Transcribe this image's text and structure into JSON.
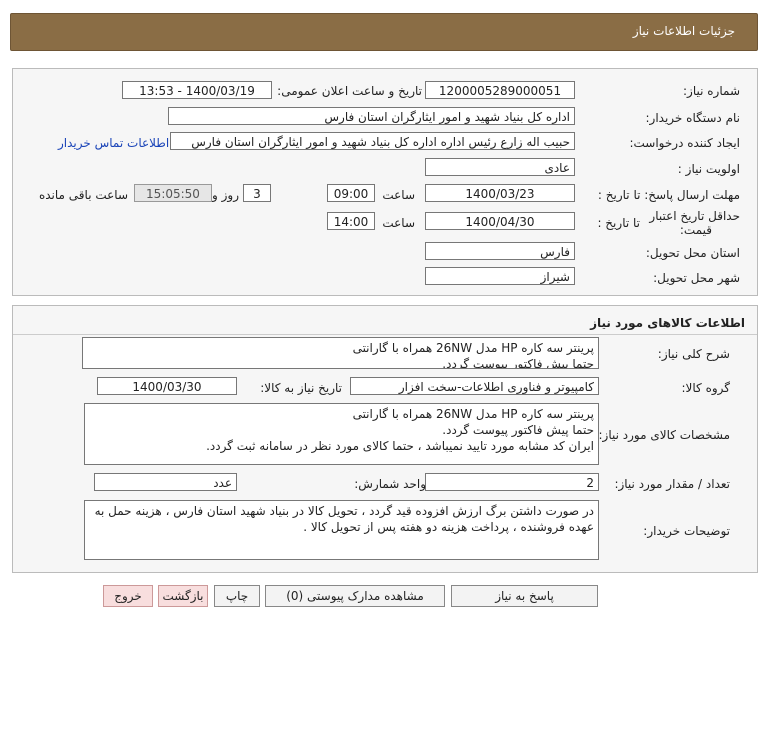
{
  "header": {
    "title": "جزئیات اطلاعات نیاز"
  },
  "info": {
    "need_no_label": "شماره نیاز:",
    "need_no": "1200005289000051",
    "announce_label": "تاریخ و ساعت اعلان عمومی:",
    "announce_value": "1400/03/19 - 13:53",
    "buyer_label": "نام دستگاه خریدار:",
    "buyer": "اداره کل بنیاد شهید و امور ایثارگران استان فارس",
    "creator_label": "ایجاد کننده درخواست:",
    "creator": "حبیب اله زارع رئیس اداره اداره کل بنیاد شهید و امور ایثارگران استان فارس",
    "contact_link": "اطلاعات تماس خریدار",
    "priority_label": "اولویت نیاز :",
    "priority": "عادی",
    "deadline_label": "مهلت ارسال پاسخ: تا تاریخ :",
    "deadline_date": "1400/03/23",
    "time_label": "ساعت",
    "deadline_time": "09:00",
    "days": "3",
    "days_label": "روز و",
    "remaining": "15:05:50",
    "remaining_label": "ساعت باقی مانده",
    "validity_label": "حداقل تاریخ اعتبار قیمت:",
    "validity_to_label": "تا تاریخ :",
    "validity_date": "1400/04/30",
    "validity_time_label": "ساعت",
    "validity_time": "14:00",
    "province_label": "استان محل تحویل:",
    "province": "فارس",
    "city_label": "شهر محل تحویل:",
    "city": "شیراز"
  },
  "goods": {
    "title": "اطلاعات کالاهای مورد نیاز",
    "desc_label": "شرح کلی نیاز:",
    "desc_line1": "پرینتر سه کاره HP مدل 26NW همراه با گارانتی",
    "desc_line2": "حتما پیش فاکتور پیوست گردد.",
    "group_label": "گروه کالا:",
    "group": "کامپیوتر و فناوری اطلاعات-سخت افزار",
    "need_date_label": "تاریخ نیاز به کالا:",
    "need_date": "1400/03/30",
    "spec_label": "مشخصات کالای مورد نیاز:",
    "spec_line1": "پرینتر سه کاره HP مدل 26NW همراه با گارانتی",
    "spec_line2": "حتما پیش فاکتور پیوست گردد.",
    "spec_line3": "ایران کد مشابه مورد تایید نمیباشد ، حتما کالای مورد نظر در سامانه ثبت گردد.",
    "qty_label": "تعداد / مقدار مورد نیاز:",
    "qty": "2",
    "unit_label": "واحد شمارش:",
    "unit": "عدد",
    "notes_label": "توضیحات خریدار:",
    "notes_line1": "در صورت داشتن برگ ارزش افزوده قید گردد ، تحویل کالا در بنیاد شهید استان فارس ، هزینه حمل به",
    "notes_line2": "عهده فروشنده ، پرداخت هزینه دو هفته پس از تحویل کالا ."
  },
  "buttons": {
    "reply": "پاسخ به نیاز",
    "attachments": "مشاهده مدارک پیوستی (0)",
    "print": "چاپ",
    "back": "بازگشت",
    "exit": "خروج"
  }
}
